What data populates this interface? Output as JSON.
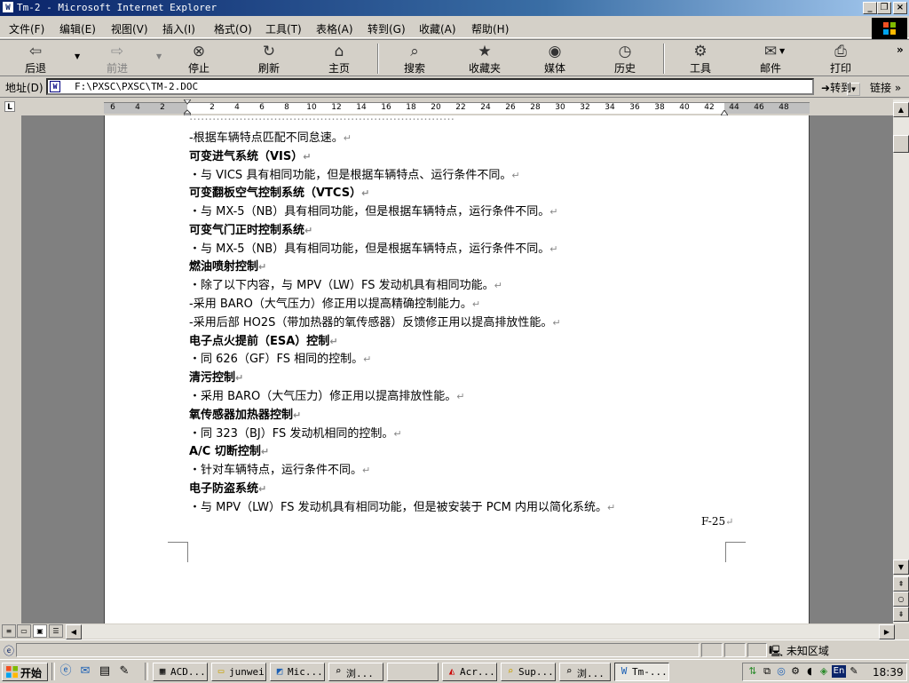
{
  "window": {
    "title": "Tm-2 - Microsoft Internet Explorer",
    "app_icon": "ie-doc-icon",
    "buttons": [
      "_",
      "❐",
      "×"
    ]
  },
  "menu": [
    "文件(F)",
    "编辑(E)",
    "视图(V)",
    "插入(I)",
    "格式(O)",
    "工具(T)",
    "表格(A)",
    "转到(G)",
    "收藏(A)",
    "帮助(H)"
  ],
  "toolbar": {
    "back": "后退",
    "forward": "前进",
    "stop": "停止",
    "refresh": "刷新",
    "home": "主页",
    "search": "搜索",
    "favorites": "收藏夹",
    "media": "媒体",
    "history": "历史",
    "tools": "工具",
    "mail": "邮件",
    "print": "打印",
    "more": "»"
  },
  "address": {
    "label": "地址(D)",
    "value": "F:\\PXSC\\PXSC\\TM-2.DOC",
    "go": "转到",
    "links": "链接 »"
  },
  "ruler": {
    "tab_marker": "L",
    "numbers": [
      "6",
      "4",
      "2",
      "",
      "2",
      "4",
      "6",
      "8",
      "10",
      "12",
      "14",
      "16",
      "18",
      "20",
      "22",
      "24",
      "26",
      "28",
      "30",
      "32",
      "34",
      "36",
      "38",
      "40",
      "42",
      "44",
      "46",
      "48"
    ]
  },
  "document": {
    "lines": [
      {
        "text": "…………………………………………………………………………………………………………………………………",
        "bold": false,
        "partial": true
      },
      {
        "text": "-根据车辆特点匹配不同怠速。",
        "bold": false
      },
      {
        "text": "可变进气系统（VIS）",
        "bold": true
      },
      {
        "text": "・与 VICS 具有相同功能，但是根据车辆特点、运行条件不同。",
        "bold": false
      },
      {
        "text": "可变翻板空气控制系统（VTCS）",
        "bold": true
      },
      {
        "text": "・与 MX-5（NB）具有相同功能，但是根据车辆特点，运行条件不同。",
        "bold": false
      },
      {
        "text": "可变气门正时控制系统",
        "bold": true
      },
      {
        "text": "・与 MX-5（NB）具有相同功能，但是根据车辆特点，运行条件不同。",
        "bold": false
      },
      {
        "text": "燃油喷射控制",
        "bold": true
      },
      {
        "text": "・除了以下内容，与 MPV（LW）FS 发动机具有相同功能。",
        "bold": false
      },
      {
        "text": "-采用 BARO（大气压力）修正用以提高精确控制能力。",
        "bold": false
      },
      {
        "text": "-采用后部 HO2S（带加热器的氧传感器）反馈修正用以提高排放性能。",
        "bold": false
      },
      {
        "text": "电子点火提前（ESA）控制",
        "bold": true
      },
      {
        "text": "・同 626（GF）FS 相同的控制。",
        "bold": false
      },
      {
        "text": "清污控制",
        "bold": true
      },
      {
        "text": "・采用 BARO（大气压力）修正用以提高排放性能。",
        "bold": false
      },
      {
        "text": "氧传感器加热器控制",
        "bold": true
      },
      {
        "text": "・同 323（BJ）FS 发动机相同的控制。",
        "bold": false
      },
      {
        "text": "A/C 切断控制",
        "bold": true
      },
      {
        "text": "・针对车辆特点，运行条件不同。",
        "bold": false
      },
      {
        "text": "电子防盗系统",
        "bold": true
      },
      {
        "text": "・与 MPV（LW）FS 发动机具有相同功能，但是被安装于 PCM 内用以简化系统。",
        "bold": false
      }
    ],
    "paragraph_mark": "↵",
    "page_number": "F-25"
  },
  "statusbar": {
    "zone": "未知区域"
  },
  "taskbar": {
    "start": "开始",
    "tasks": [
      {
        "label": "ACD...",
        "icon": "acdsee-icon"
      },
      {
        "label": "junwei",
        "icon": "folder-icon"
      },
      {
        "label": "Mic...",
        "icon": "outlook-icon"
      },
      {
        "label": "浏...",
        "icon": "browse-icon"
      },
      {
        "label": "",
        "icon": ""
      },
      {
        "label": "Acr...",
        "icon": "acrobat-icon"
      },
      {
        "label": "Sup...",
        "icon": "folder-search-icon"
      },
      {
        "label": "浏...",
        "icon": "browse-icon"
      },
      {
        "label": "Tm-...",
        "icon": "ie-doc-icon",
        "active": true
      }
    ],
    "lang": "En",
    "clock": "18:39"
  }
}
